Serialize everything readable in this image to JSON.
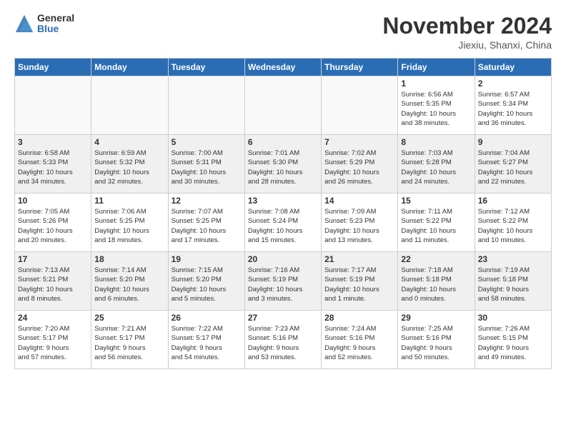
{
  "logo": {
    "general": "General",
    "blue": "Blue"
  },
  "title": "November 2024",
  "subtitle": "Jiexiu, Shanxi, China",
  "days_of_week": [
    "Sunday",
    "Monday",
    "Tuesday",
    "Wednesday",
    "Thursday",
    "Friday",
    "Saturday"
  ],
  "weeks": [
    [
      {
        "num": "",
        "info": ""
      },
      {
        "num": "",
        "info": ""
      },
      {
        "num": "",
        "info": ""
      },
      {
        "num": "",
        "info": ""
      },
      {
        "num": "",
        "info": ""
      },
      {
        "num": "1",
        "info": "Sunrise: 6:56 AM\nSunset: 5:35 PM\nDaylight: 10 hours\nand 38 minutes."
      },
      {
        "num": "2",
        "info": "Sunrise: 6:57 AM\nSunset: 5:34 PM\nDaylight: 10 hours\nand 36 minutes."
      }
    ],
    [
      {
        "num": "3",
        "info": "Sunrise: 6:58 AM\nSunset: 5:33 PM\nDaylight: 10 hours\nand 34 minutes."
      },
      {
        "num": "4",
        "info": "Sunrise: 6:59 AM\nSunset: 5:32 PM\nDaylight: 10 hours\nand 32 minutes."
      },
      {
        "num": "5",
        "info": "Sunrise: 7:00 AM\nSunset: 5:31 PM\nDaylight: 10 hours\nand 30 minutes."
      },
      {
        "num": "6",
        "info": "Sunrise: 7:01 AM\nSunset: 5:30 PM\nDaylight: 10 hours\nand 28 minutes."
      },
      {
        "num": "7",
        "info": "Sunrise: 7:02 AM\nSunset: 5:29 PM\nDaylight: 10 hours\nand 26 minutes."
      },
      {
        "num": "8",
        "info": "Sunrise: 7:03 AM\nSunset: 5:28 PM\nDaylight: 10 hours\nand 24 minutes."
      },
      {
        "num": "9",
        "info": "Sunrise: 7:04 AM\nSunset: 5:27 PM\nDaylight: 10 hours\nand 22 minutes."
      }
    ],
    [
      {
        "num": "10",
        "info": "Sunrise: 7:05 AM\nSunset: 5:26 PM\nDaylight: 10 hours\nand 20 minutes."
      },
      {
        "num": "11",
        "info": "Sunrise: 7:06 AM\nSunset: 5:25 PM\nDaylight: 10 hours\nand 18 minutes."
      },
      {
        "num": "12",
        "info": "Sunrise: 7:07 AM\nSunset: 5:25 PM\nDaylight: 10 hours\nand 17 minutes."
      },
      {
        "num": "13",
        "info": "Sunrise: 7:08 AM\nSunset: 5:24 PM\nDaylight: 10 hours\nand 15 minutes."
      },
      {
        "num": "14",
        "info": "Sunrise: 7:09 AM\nSunset: 5:23 PM\nDaylight: 10 hours\nand 13 minutes."
      },
      {
        "num": "15",
        "info": "Sunrise: 7:11 AM\nSunset: 5:22 PM\nDaylight: 10 hours\nand 11 minutes."
      },
      {
        "num": "16",
        "info": "Sunrise: 7:12 AM\nSunset: 5:22 PM\nDaylight: 10 hours\nand 10 minutes."
      }
    ],
    [
      {
        "num": "17",
        "info": "Sunrise: 7:13 AM\nSunset: 5:21 PM\nDaylight: 10 hours\nand 8 minutes."
      },
      {
        "num": "18",
        "info": "Sunrise: 7:14 AM\nSunset: 5:20 PM\nDaylight: 10 hours\nand 6 minutes."
      },
      {
        "num": "19",
        "info": "Sunrise: 7:15 AM\nSunset: 5:20 PM\nDaylight: 10 hours\nand 5 minutes."
      },
      {
        "num": "20",
        "info": "Sunrise: 7:16 AM\nSunset: 5:19 PM\nDaylight: 10 hours\nand 3 minutes."
      },
      {
        "num": "21",
        "info": "Sunrise: 7:17 AM\nSunset: 5:19 PM\nDaylight: 10 hours\nand 1 minute."
      },
      {
        "num": "22",
        "info": "Sunrise: 7:18 AM\nSunset: 5:18 PM\nDaylight: 10 hours\nand 0 minutes."
      },
      {
        "num": "23",
        "info": "Sunrise: 7:19 AM\nSunset: 5:18 PM\nDaylight: 9 hours\nand 58 minutes."
      }
    ],
    [
      {
        "num": "24",
        "info": "Sunrise: 7:20 AM\nSunset: 5:17 PM\nDaylight: 9 hours\nand 57 minutes."
      },
      {
        "num": "25",
        "info": "Sunrise: 7:21 AM\nSunset: 5:17 PM\nDaylight: 9 hours\nand 56 minutes."
      },
      {
        "num": "26",
        "info": "Sunrise: 7:22 AM\nSunset: 5:17 PM\nDaylight: 9 hours\nand 54 minutes."
      },
      {
        "num": "27",
        "info": "Sunrise: 7:23 AM\nSunset: 5:16 PM\nDaylight: 9 hours\nand 53 minutes."
      },
      {
        "num": "28",
        "info": "Sunrise: 7:24 AM\nSunset: 5:16 PM\nDaylight: 9 hours\nand 52 minutes."
      },
      {
        "num": "29",
        "info": "Sunrise: 7:25 AM\nSunset: 5:16 PM\nDaylight: 9 hours\nand 50 minutes."
      },
      {
        "num": "30",
        "info": "Sunrise: 7:26 AM\nSunset: 5:15 PM\nDaylight: 9 hours\nand 49 minutes."
      }
    ]
  ]
}
